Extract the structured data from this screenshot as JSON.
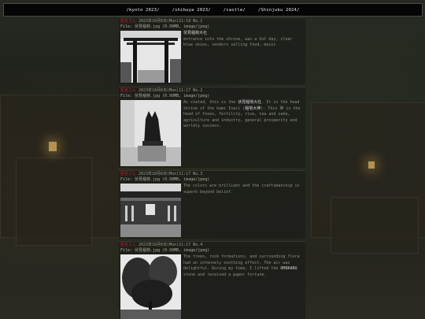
{
  "nav": {
    "links": [
      "/kyoto 2023/",
      "/shibuya 2023/",
      "/castle/",
      "/Shinjuku 2024/"
    ]
  },
  "posts": [
    {
      "name": "匿名さん",
      "date": "2023年10月6日(Mon)11:19 No.1",
      "file": "File: 伏見稲荷.jpg (0.99MB, image/jpeg)",
      "title": "伏見稲荷大社",
      "body": "entrance into the shrine, was a hot day, clear blue skies, vendors selling food, music"
    },
    {
      "name": "匿名さん",
      "date": "2023年10月6日(Mon)11:17 No.2",
      "file": "File: 伏見稲荷.jpg (0.99MB, image/jpeg)",
      "body_pre": "As stated, this is the ",
      "body_hl1": "伏見稲荷大社",
      "body_mid": ". It is the head shrine of the kami Inari (",
      "body_hl2": "稲荷大神",
      "body_post": "). This 神 is the head of foxes, fertility, rice, tea and sake, agriculture and industry, general prosperity and worldly success."
    },
    {
      "name": "匿名さん",
      "date": "2023年10月6日(Mon)11:17 No.3",
      "file": "File: 伏見稲荷.jpg (0.99MB, image/jpeg)",
      "body": "The colors are brilliant and the craftsmanship is superb beyond belief."
    },
    {
      "name": "匿名さん",
      "date": "2023年10月6日(Mon)11:17 No.4",
      "file": "File: 伏見稲荷.jpg (0.99MB, image/jpeg)",
      "body_pre": "The trees, rock formations, and surrounding flora had an intensely soothing effect. The air was delightful. During my time, I lifted the ",
      "body_hl1": "OMOKARU",
      "body_post": " stone and received a paper fortune."
    }
  ],
  "colors": {
    "name": "#c0202a",
    "meta": "#9aa08e",
    "body": "#8d9283",
    "nav_bg": "#050505"
  }
}
